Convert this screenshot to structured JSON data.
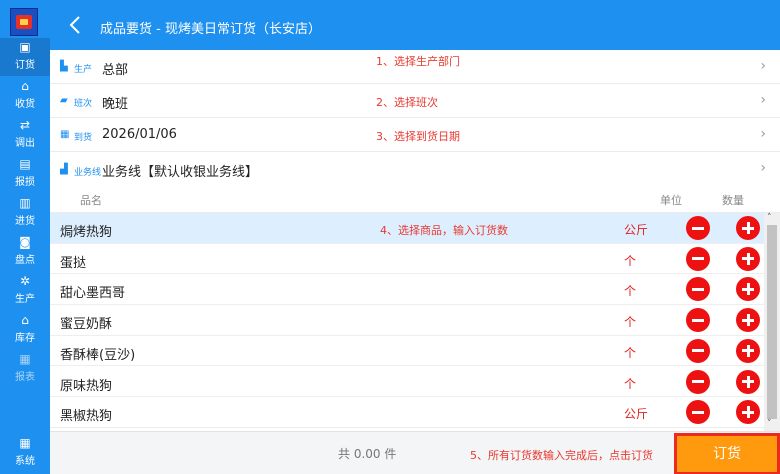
{
  "header": {
    "title": "成品要货 - 现烤美日常订货（长安店）",
    "back_icon": "chevron-left-icon"
  },
  "sidebar": {
    "items": [
      {
        "label": "订货",
        "icon": "order-icon",
        "active": true
      },
      {
        "label": "收货",
        "icon": "receive-icon"
      },
      {
        "label": "调出",
        "icon": "transfer-out-icon"
      },
      {
        "label": "报损",
        "icon": "damage-report-icon"
      },
      {
        "label": "进货",
        "icon": "purchase-icon"
      },
      {
        "label": "盘点",
        "icon": "inventory-count-icon"
      },
      {
        "label": "生产",
        "icon": "production-icon"
      },
      {
        "label": "库存",
        "icon": "stock-icon"
      },
      {
        "label": "报表",
        "icon": "report-icon",
        "disabled": true
      },
      {
        "label": "系统",
        "icon": "grid-icon"
      }
    ]
  },
  "form": {
    "production": {
      "label": "生产",
      "value": "总部",
      "hint": "1、选择生产部门"
    },
    "shift": {
      "label": "班次",
      "value": "晚班",
      "hint": "2、选择班次"
    },
    "arrival": {
      "label": "到货",
      "value": "2026/01/06",
      "hint": "3、选择到货日期"
    },
    "business_line": {
      "label": "业务线",
      "value": "业务线【默认收银业务线】"
    }
  },
  "table": {
    "headers": {
      "name": "品名",
      "unit": "单位",
      "qty": "数量"
    },
    "hint": "4、选择商品，输入订货数",
    "rows": [
      {
        "name": "焗烤热狗",
        "unit": "公斤"
      },
      {
        "name": "蛋挞",
        "unit": "个"
      },
      {
        "name": "甜心墨西哥",
        "unit": "个"
      },
      {
        "name": "蜜豆奶酥",
        "unit": "个"
      },
      {
        "name": "香酥棒(豆沙)",
        "unit": "个"
      },
      {
        "name": "原味热狗",
        "unit": "个"
      },
      {
        "name": "黑椒热狗",
        "unit": "公斤"
      }
    ]
  },
  "footer": {
    "total": "共 0.00 件",
    "hint": "5、所有订货数输入完成后，点击订货",
    "order_label": "订货"
  },
  "colors": {
    "primary": "#1e90f0",
    "accent": "#ff9a0e",
    "danger": "#ee1111",
    "hint": "#e8392f"
  }
}
